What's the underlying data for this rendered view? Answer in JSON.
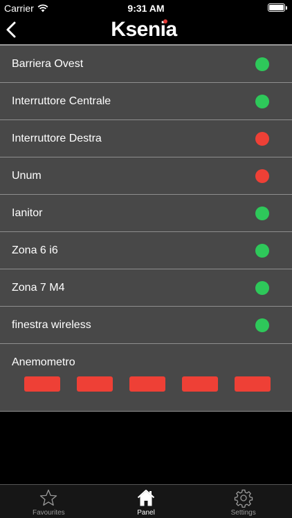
{
  "status_bar": {
    "carrier": "Carrier",
    "time": "9:31 AM"
  },
  "nav": {
    "logo_part1": "K",
    "logo_part2": "senia"
  },
  "colors": {
    "green": "#2ec85a",
    "red": "#ee4036",
    "row_bg": "#484848"
  },
  "zones": [
    {
      "label": "Barriera Ovest",
      "status": "green"
    },
    {
      "label": "Interruttore Centrale",
      "status": "green"
    },
    {
      "label": "Interruttore Destra",
      "status": "red"
    },
    {
      "label": "Unum",
      "status": "red"
    },
    {
      "label": "Ianitor",
      "status": "green"
    },
    {
      "label": "Zona 6 i6",
      "status": "green"
    },
    {
      "label": "Zona 7 M4",
      "status": "green"
    },
    {
      "label": "finestra wireless",
      "status": "green"
    }
  ],
  "anemometer": {
    "label": "Anemometro",
    "bars": [
      "red",
      "red",
      "red",
      "red",
      "red"
    ]
  },
  "tabs": [
    {
      "label": "Favourites",
      "icon": "star-icon",
      "active": false
    },
    {
      "label": "Panel",
      "icon": "home-icon",
      "active": true
    },
    {
      "label": "Settings",
      "icon": "gear-icon",
      "active": false
    }
  ]
}
